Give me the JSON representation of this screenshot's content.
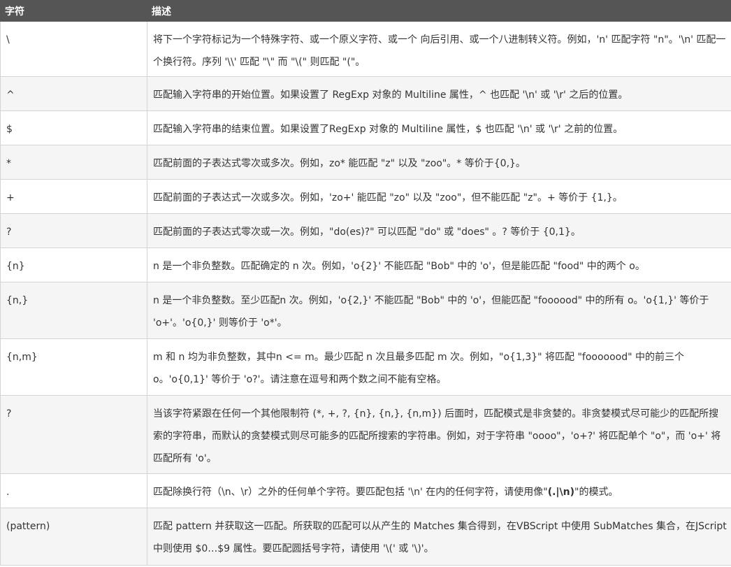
{
  "header": {
    "col1": "字符",
    "col2": "描述"
  },
  "rows": [
    {
      "char": "\\",
      "desc": "将下一个字符标记为一个特殊字符、或一个原义字符、或一个 向后引用、或一个八进制转义符。例如，'n' 匹配字符 \"n\"。'\\n' 匹配一个换行符。序列 '\\\\' 匹配 \"\\\" 而 \"\\(\" 则匹配 \"(\"。"
    },
    {
      "char": "^",
      "desc": "匹配输入字符串的开始位置。如果设置了 RegExp 对象的 Multiline 属性，^ 也匹配 '\\n' 或 '\\r' 之后的位置。"
    },
    {
      "char": "$",
      "desc": "匹配输入字符串的结束位置。如果设置了RegExp 对象的 Multiline 属性，$ 也匹配 '\\n' 或 '\\r' 之前的位置。"
    },
    {
      "char": "*",
      "desc": "匹配前面的子表达式零次或多次。例如，zo* 能匹配 \"z\" 以及 \"zoo\"。* 等价于{0,}。"
    },
    {
      "char": "+",
      "desc": "匹配前面的子表达式一次或多次。例如，'zo+' 能匹配 \"zo\" 以及 \"zoo\"，但不能匹配 \"z\"。+ 等价于 {1,}。"
    },
    {
      "char": "?",
      "desc": "匹配前面的子表达式零次或一次。例如，\"do(es)?\" 可以匹配 \"do\" 或 \"does\" 。? 等价于 {0,1}。"
    },
    {
      "char": "{n}",
      "desc": "n 是一个非负整数。匹配确定的 n 次。例如，'o{2}' 不能匹配 \"Bob\" 中的 'o'，但是能匹配 \"food\" 中的两个 o。"
    },
    {
      "char": "{n,}",
      "desc": "n 是一个非负整数。至少匹配n 次。例如，'o{2,}' 不能匹配 \"Bob\" 中的 'o'，但能匹配 \"foooood\" 中的所有 o。'o{1,}' 等价于 'o+'。'o{0,}' 则等价于 'o*'。"
    },
    {
      "char": "{n,m}",
      "desc": "m 和 n 均为非负整数，其中n <= m。最少匹配 n 次且最多匹配 m 次。例如，\"o{1,3}\" 将匹配 \"fooooood\" 中的前三个 o。'o{0,1}' 等价于 'o?'。请注意在逗号和两个数之间不能有空格。"
    },
    {
      "char": "?",
      "desc": "当该字符紧跟在任何一个其他限制符 (*, +, ?, {n}, {n,}, {n,m}) 后面时，匹配模式是非贪婪的。非贪婪模式尽可能少的匹配所搜索的字符串，而默认的贪婪模式则尽可能多的匹配所搜索的字符串。例如，对于字符串 \"oooo\"，'o+?' 将匹配单个 \"o\"，而 'o+' 将匹配所有 'o'。"
    },
    {
      "char": ".",
      "desc_before": "匹配除换行符（\\n、\\r）之外的任何单个字符。要匹配包括 '\\n' 在内的任何字符，请使用像\"",
      "desc_bold": "(.|\\n)",
      "desc_after": "\"的模式。"
    },
    {
      "char": "(pattern)",
      "desc": "匹配 pattern 并获取这一匹配。所获取的匹配可以从产生的 Matches 集合得到，在VBScript 中使用 SubMatches 集合，在JScript 中则使用 $0…$9 属性。要匹配圆括号字符，请使用 '\\(' 或 '\\)'。"
    }
  ]
}
